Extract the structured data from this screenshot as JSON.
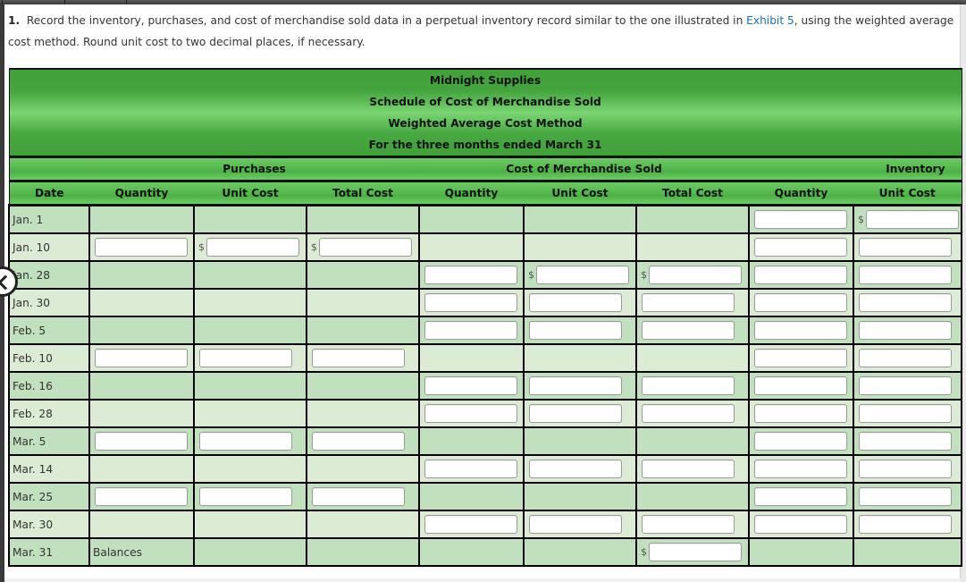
{
  "instructions": {
    "number": "1.",
    "text_before_link": "Record the inventory, purchases, and cost of merchandise sold data in a perpetual inventory record similar to the one illustrated in ",
    "link_text": "Exhibit 5",
    "text_after_link": ", using the weighted average cost method. Round unit cost to two decimal places, if necessary."
  },
  "schedule": {
    "company": "Midnight Supplies",
    "title": "Schedule of Cost of Merchandise Sold",
    "method": "Weighted Average Cost Method",
    "period": "For the three months ended March 31"
  },
  "groups": {
    "purchases": "Purchases",
    "cost_of_merchandise_sold": "Cost of Merchandise Sold",
    "inventory": "Inventory"
  },
  "columns": [
    "Date",
    "Quantity",
    "Unit Cost",
    "Total Cost",
    "Quantity",
    "Unit Cost",
    "Total Cost",
    "Quantity",
    "Unit Cost"
  ],
  "currency_symbol": "$",
  "rows": [
    {
      "date": "Jan. 1",
      "label": "",
      "cells": [
        0,
        0,
        0,
        0,
        0,
        0,
        1,
        2
      ]
    },
    {
      "date": "Jan. 10",
      "label": "",
      "cells": [
        1,
        2,
        2,
        0,
        0,
        0,
        1,
        1
      ]
    },
    {
      "date": "Jan. 28",
      "label": "",
      "cells": [
        0,
        0,
        0,
        1,
        2,
        2,
        1,
        1
      ]
    },
    {
      "date": "Jan. 30",
      "label": "",
      "cells": [
        0,
        0,
        0,
        1,
        1,
        1,
        1,
        1
      ]
    },
    {
      "date": "Feb. 5",
      "label": "",
      "cells": [
        0,
        0,
        0,
        1,
        1,
        1,
        1,
        1
      ]
    },
    {
      "date": "Feb. 10",
      "label": "",
      "cells": [
        1,
        1,
        1,
        0,
        0,
        0,
        1,
        1
      ]
    },
    {
      "date": "Feb. 16",
      "label": "",
      "cells": [
        0,
        0,
        0,
        1,
        1,
        1,
        1,
        1
      ]
    },
    {
      "date": "Feb. 28",
      "label": "",
      "cells": [
        0,
        0,
        0,
        1,
        1,
        1,
        1,
        1
      ]
    },
    {
      "date": "Mar. 5",
      "label": "",
      "cells": [
        1,
        1,
        1,
        0,
        0,
        0,
        1,
        1
      ]
    },
    {
      "date": "Mar. 14",
      "label": "",
      "cells": [
        0,
        0,
        0,
        1,
        1,
        1,
        1,
        1
      ]
    },
    {
      "date": "Mar. 25",
      "label": "",
      "cells": [
        1,
        1,
        1,
        0,
        0,
        0,
        1,
        1
      ]
    },
    {
      "date": "Mar. 30",
      "label": "",
      "cells": [
        0,
        0,
        0,
        1,
        1,
        1,
        1,
        1
      ]
    },
    {
      "date": "Mar. 31",
      "label": "Balances",
      "cells": [
        0,
        0,
        0,
        0,
        0,
        2,
        0,
        0
      ]
    }
  ],
  "cell_legend": {
    "0": "empty",
    "1": "input",
    "2": "input-with-dollar"
  }
}
